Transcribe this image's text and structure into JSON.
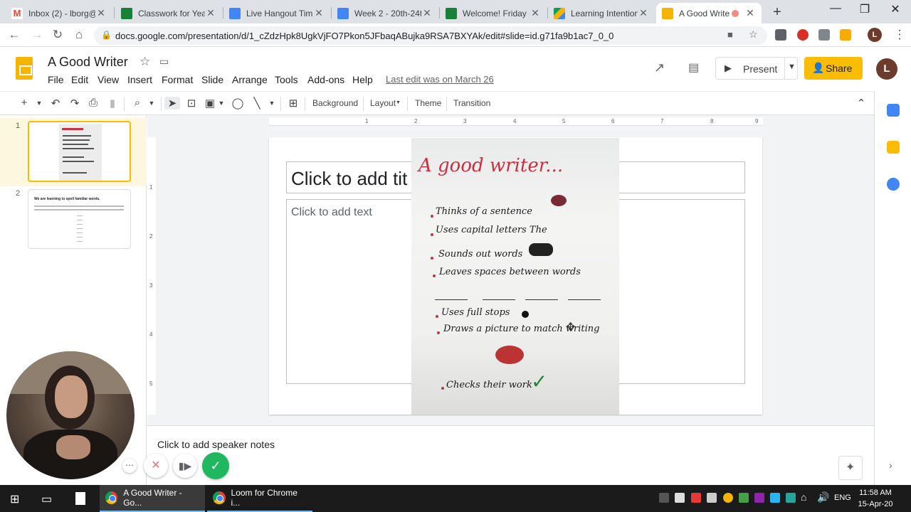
{
  "browser": {
    "tabs": [
      {
        "title": "Inbox (2) - lborg@",
        "favicon": "gmail-icon",
        "color": "#ea4335"
      },
      {
        "title": "Classwork for Year",
        "favicon": "classroom-icon",
        "color": "#188038"
      },
      {
        "title": "Live Hangout Tim",
        "favicon": "docs-icon",
        "color": "#4285f4"
      },
      {
        "title": "Week 2 - 20th-24t",
        "favicon": "docs-icon",
        "color": "#4285f4"
      },
      {
        "title": "Welcome! Friday -",
        "favicon": "classroom-icon",
        "color": "#188038"
      },
      {
        "title": "Learning Intention",
        "favicon": "drive-icon",
        "color": "#f4b400"
      },
      {
        "title": "A Good Write",
        "favicon": "slides-icon",
        "color": "#f4b400"
      }
    ],
    "url": "docs.google.com/presentation/d/1_cZdzHpk8UgkVjFO7Pkon5JFbaqABujka9RSA7BXYAk/edit#slide=id.g71fa9b1ac7_0_0"
  },
  "doc": {
    "title": "A Good Writer",
    "menus": [
      "File",
      "Edit",
      "View",
      "Insert",
      "Format",
      "Slide",
      "Arrange",
      "Tools",
      "Add-ons",
      "Help"
    ],
    "last_edit": "Last edit was on March 26",
    "present_label": "Present",
    "share_label": "Share",
    "avatar_letter": "L"
  },
  "toolbar": {
    "background": "Background",
    "layout": "Layout",
    "theme": "Theme",
    "transition": "Transition"
  },
  "filmstrip": {
    "slides": [
      {
        "number": "1",
        "selected": true
      },
      {
        "number": "2",
        "selected": false,
        "heading": "We are learning to spell familiar words."
      }
    ]
  },
  "ruler": {
    "h": [
      "1",
      "2",
      "3",
      "4",
      "5",
      "6",
      "7",
      "8",
      "9"
    ],
    "v": [
      "1",
      "2",
      "3",
      "4",
      "5"
    ]
  },
  "slide": {
    "title_placeholder": "Click to add tit",
    "body_placeholder": "Click to add text",
    "poster": {
      "heading": "A good writer...",
      "items": [
        "Thinks of a sentence",
        "Uses capital letters The",
        "Sounds out words",
        "Leaves spaces between words",
        "Uses full stops",
        "Draws a picture to match writing",
        "Checks their work"
      ]
    }
  },
  "notes": {
    "placeholder": "Click to add speaker notes"
  },
  "taskbar": {
    "apps": [
      "A Good Writer - Go...",
      "Loom for Chrome i..."
    ],
    "lang": "ENG",
    "time": "11:58 AM",
    "date": "15-Apr-20"
  },
  "colors": {
    "accent": "#fbbc04",
    "selected_thumb_bg": "#fef7e0",
    "poster_heading": "#c9303f"
  }
}
